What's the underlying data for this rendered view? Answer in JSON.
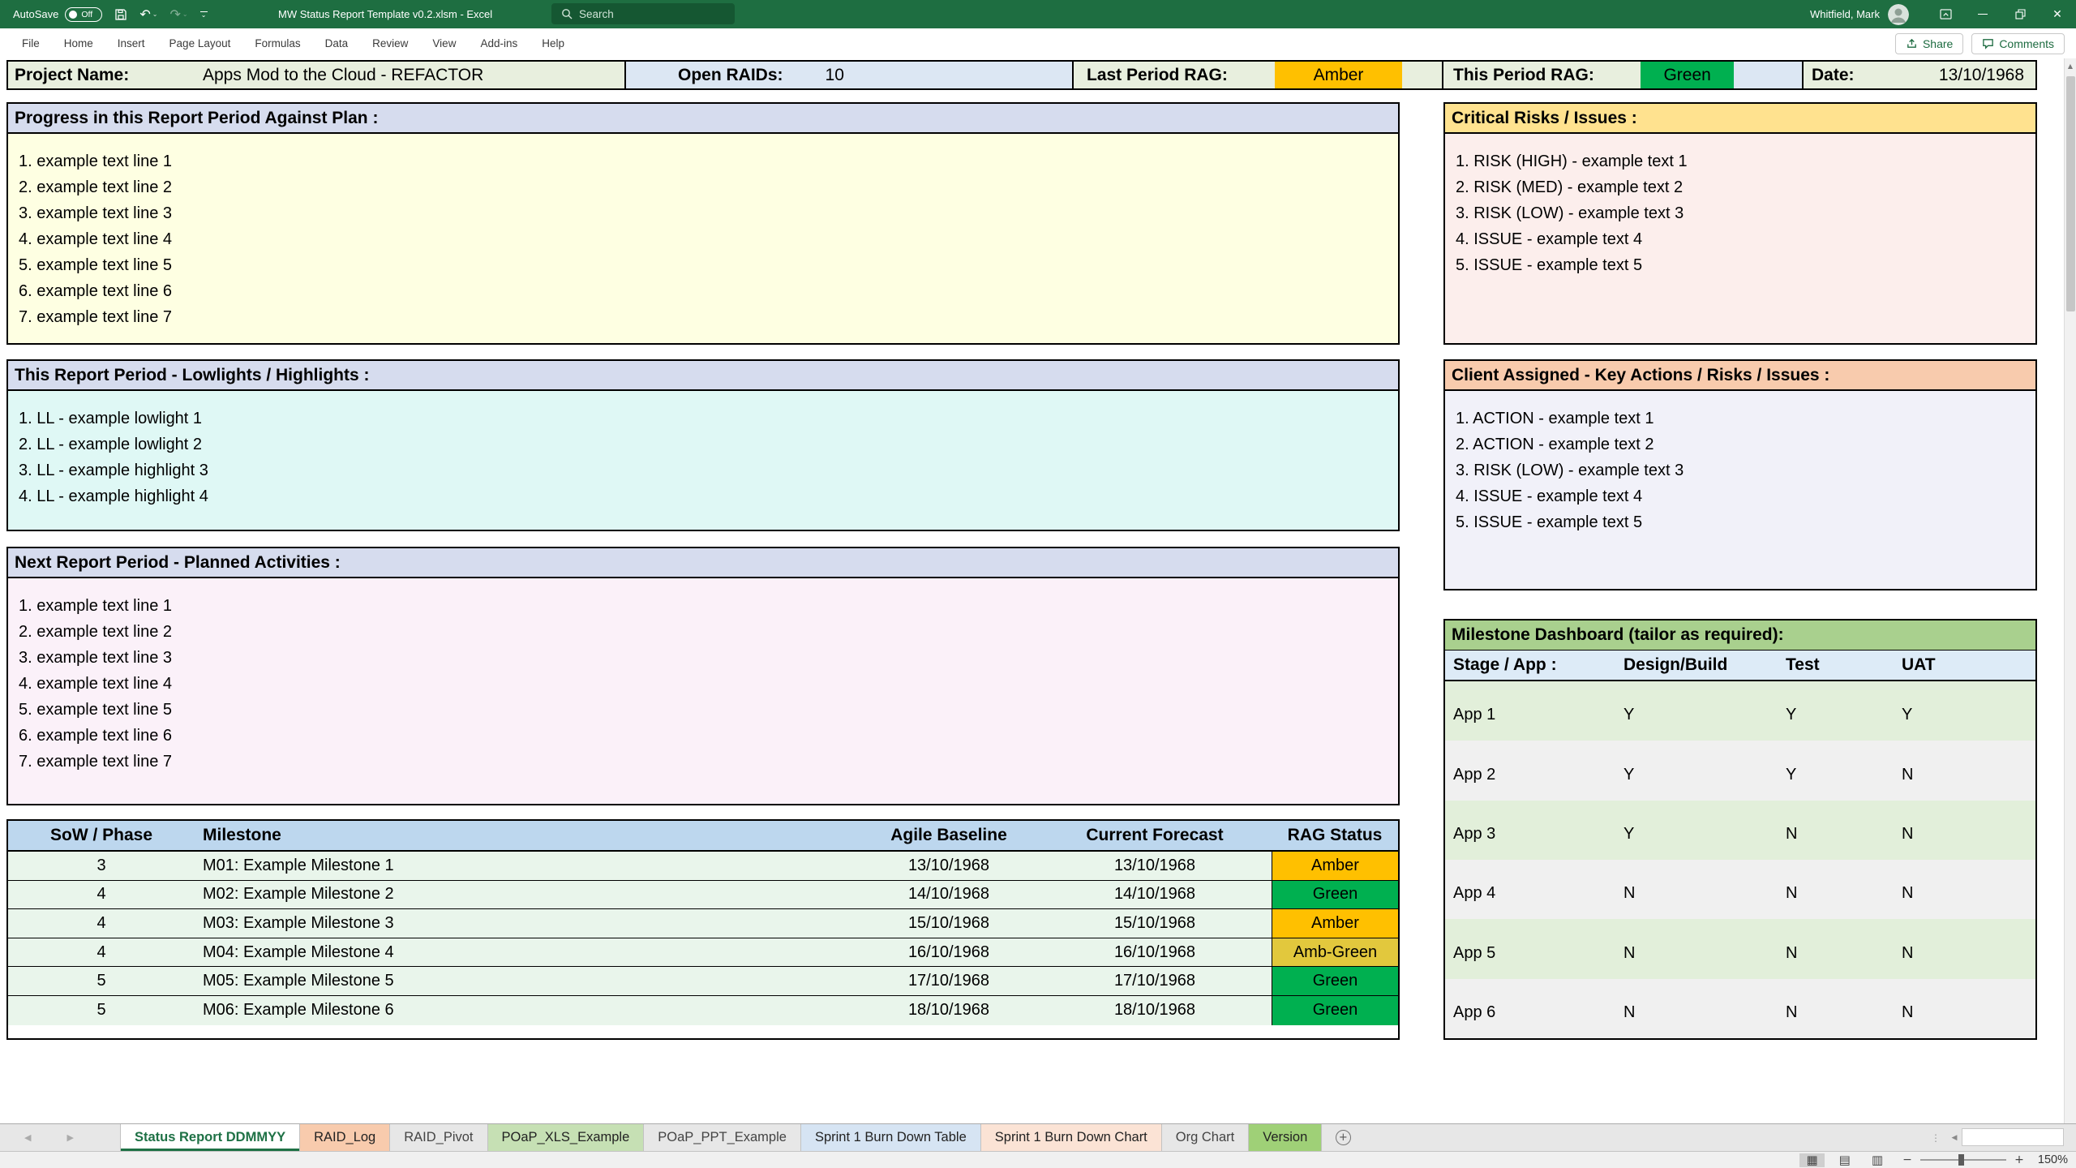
{
  "titlebar": {
    "autosave_label": "AutoSave",
    "autosave_state": "Off",
    "search_placeholder": "Search",
    "title": "MW Status Report Template v0.2.xlsm  -  Excel",
    "user_name": "Whitfield, Mark"
  },
  "menubar": {
    "items": [
      "File",
      "Home",
      "Insert",
      "Page Layout",
      "Formulas",
      "Data",
      "Review",
      "View",
      "Add-ins",
      "Help"
    ],
    "share_label": "Share",
    "comments_label": "Comments"
  },
  "header": {
    "project_name_label": "Project Name:",
    "project_name_value": "Apps Mod to the Cloud - REFACTOR",
    "open_raids_label": "Open RAIDs:",
    "open_raids_value": "10",
    "last_period_rag_label": "Last Period RAG:",
    "last_period_rag_value": "Amber",
    "last_period_rag_color": "#FFC000",
    "this_period_rag_label": "This Period RAG:",
    "this_period_rag_value": "Green",
    "this_period_rag_color": "#00B050",
    "date_label": "Date:",
    "date_value": "13/10/1968"
  },
  "sections": {
    "progress": {
      "title": "Progress in this Report Period Against Plan :",
      "lines": [
        "1. example text line 1",
        "2. example text line 2",
        "3. example text line 3",
        "4. example text line 4",
        "5. example text line 5",
        "6. example text line 6",
        "7. example text line 7"
      ]
    },
    "critical": {
      "title": "Critical Risks / Issues :",
      "lines": [
        "1. RISK (HIGH) - example text 1",
        "2. RISK (MED) - example text 2",
        "3. RISK (LOW) - example text 3",
        "4. ISSUE - example text 4",
        "5. ISSUE - example text 5"
      ]
    },
    "lowlights": {
      "title": "This Report Period - Lowlights / Highlights :",
      "lines": [
        "1. LL - example lowlight 1",
        "2. LL - example lowlight 2",
        "3. LL - example highlight 3",
        "4. LL - example highlight 4"
      ]
    },
    "client": {
      "title": "Client Assigned - Key Actions / Risks / Issues :",
      "lines": [
        "1. ACTION - example text 1",
        "2. ACTION - example text 2",
        "3. RISK (LOW) - example text 3",
        "4. ISSUE - example text 4",
        "5. ISSUE - example text 5"
      ]
    },
    "planned": {
      "title": "Next Report Period - Planned Activities :",
      "lines": [
        "1. example text line 1",
        "2. example text line 2",
        "3. example text line 3",
        "4. example text line 4",
        "5. example text line 5",
        "6. example text line 6",
        "7. example text line 7"
      ]
    }
  },
  "milestone_table": {
    "headers": {
      "phase": "SoW / Phase",
      "milestone": "Milestone",
      "baseline": "Agile Baseline",
      "forecast": "Current Forecast",
      "rag": "RAG Status"
    },
    "rows": [
      {
        "phase": "3",
        "milestone": "M01: Example Milestone 1",
        "baseline": "13/10/1968",
        "forecast": "13/10/1968",
        "rag": "Amber",
        "rag_color": "#FFC000"
      },
      {
        "phase": "4",
        "milestone": "M02: Example Milestone 2",
        "baseline": "14/10/1968",
        "forecast": "14/10/1968",
        "rag": "Green",
        "rag_color": "#00B050"
      },
      {
        "phase": "4",
        "milestone": "M03: Example Milestone 3",
        "baseline": "15/10/1968",
        "forecast": "15/10/1968",
        "rag": "Amber",
        "rag_color": "#FFC000"
      },
      {
        "phase": "4",
        "milestone": "M04: Example Milestone 4",
        "baseline": "16/10/1968",
        "forecast": "16/10/1968",
        "rag": "Amb-Green",
        "rag_color": "#E2C83D"
      },
      {
        "phase": "5",
        "milestone": "M05: Example Milestone 5",
        "baseline": "17/10/1968",
        "forecast": "17/10/1968",
        "rag": "Green",
        "rag_color": "#00B050"
      },
      {
        "phase": "5",
        "milestone": "M06: Example Milestone 6",
        "baseline": "18/10/1968",
        "forecast": "18/10/1968",
        "rag": "Green",
        "rag_color": "#00B050"
      }
    ]
  },
  "dashboard": {
    "title": "Milestone Dashboard (tailor as required):",
    "headers": {
      "stage": "Stage / App :",
      "design": "Design/Build",
      "test": "Test",
      "uat": "UAT"
    },
    "rows": [
      {
        "app": "App 1",
        "design": "Y",
        "test": "Y",
        "uat": "Y"
      },
      {
        "app": "App 2",
        "design": "Y",
        "test": "Y",
        "uat": "N"
      },
      {
        "app": "App 3",
        "design": "Y",
        "test": "N",
        "uat": "N"
      },
      {
        "app": "App 4",
        "design": "N",
        "test": "N",
        "uat": "N"
      },
      {
        "app": "App 5",
        "design": "N",
        "test": "N",
        "uat": "N"
      },
      {
        "app": "App 6",
        "design": "N",
        "test": "N",
        "uat": "N"
      }
    ]
  },
  "sheet_tabs": {
    "tabs": [
      {
        "label": "Status Report DDMMYY",
        "bg": "#FFFFFF",
        "fg": "#1E7145",
        "cls": "active"
      },
      {
        "label": "RAID_Log",
        "bg": "#F8CBAD",
        "fg": "#222222",
        "cls": ""
      },
      {
        "label": "RAID_Pivot",
        "bg": "",
        "fg": "#444444",
        "cls": ""
      },
      {
        "label": "POaP_XLS_Example",
        "bg": "#C6E0B4",
        "fg": "#222222",
        "cls": ""
      },
      {
        "label": "POaP_PPT_Example",
        "bg": "",
        "fg": "#444444",
        "cls": ""
      },
      {
        "label": "Sprint 1 Burn Down Table",
        "bg": "#D6E4F3",
        "fg": "#222222",
        "cls": ""
      },
      {
        "label": "Sprint 1 Burn Down Chart",
        "bg": "#FBE3D5",
        "fg": "#222222",
        "cls": ""
      },
      {
        "label": "Org Chart",
        "bg": "",
        "fg": "#444444",
        "cls": ""
      },
      {
        "label": "Version",
        "bg": "#9FD077",
        "fg": "#222222",
        "cls": ""
      }
    ]
  },
  "status_bar": {
    "zoom_level": "150%"
  },
  "icons": {
    "prev_tab": "◀",
    "next_tab": "▶",
    "add_sheet": "+",
    "scroll_up": "▲",
    "scroll_left": "◀",
    "dots": "⋮",
    "undo": "↶",
    "redo": "↷",
    "caret": "⌄",
    "close": "✕",
    "view_normal": "▦",
    "view_layout": "▤",
    "view_break": "▥",
    "zoom_out": "−",
    "zoom_in": "+"
  }
}
